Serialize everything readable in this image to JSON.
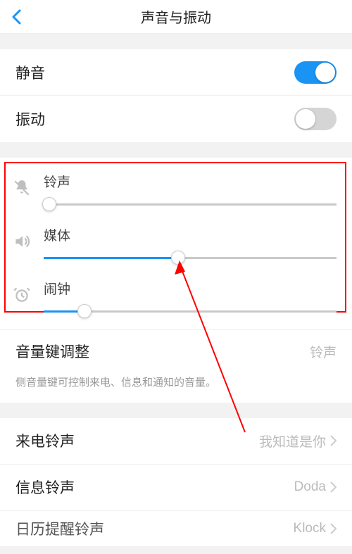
{
  "header": {
    "title": "声音与振动"
  },
  "silent": {
    "label": "静音",
    "on": true
  },
  "vibrate": {
    "label": "振动",
    "on": false
  },
  "volumes": {
    "ringtone": {
      "label": "铃声",
      "percent": 2
    },
    "media": {
      "label": "媒体",
      "percent": 46
    },
    "alarm": {
      "label": "闹钟",
      "percent": 14
    }
  },
  "volumeKey": {
    "label": "音量键调整",
    "value": "铃声",
    "note": "侧音量键可控制来电、信息和通知的音量。"
  },
  "ringtones": {
    "incoming": {
      "label": "来电铃声",
      "value": "我知道是你"
    },
    "message": {
      "label": "信息铃声",
      "value": "Doda"
    },
    "calendar": {
      "label": "日历提醒铃声",
      "value": "Klock"
    }
  },
  "colors": {
    "accent": "#1a94f4",
    "highlight": "#ff0000"
  }
}
